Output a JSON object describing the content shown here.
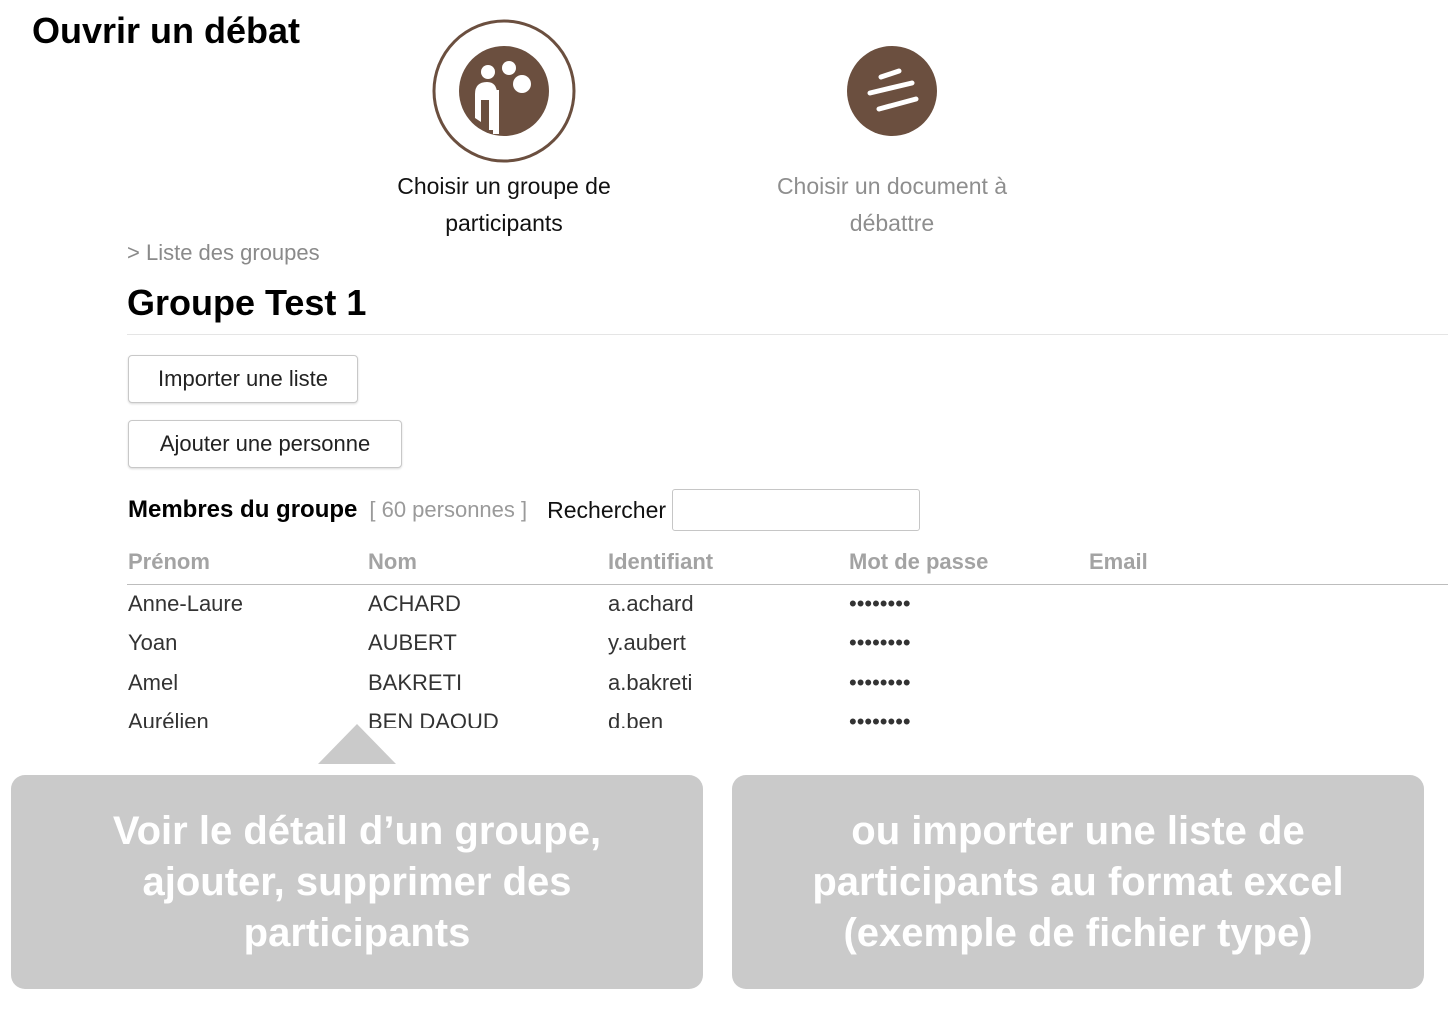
{
  "page": {
    "title": "Ouvrir un débat"
  },
  "steps": [
    {
      "label_line1": "Choisir un groupe de",
      "label_line2": "participants",
      "icon": "participants-group-icon",
      "state": "active"
    },
    {
      "label_line1": "Choisir un document à",
      "label_line2": "débattre",
      "icon": "document-icon",
      "state": "inactive"
    }
  ],
  "breadcrumb": "> Liste des groupes",
  "group": {
    "title": "Groupe Test 1"
  },
  "actions": {
    "import_label": "Importer une liste",
    "add_label": "Ajouter une personne"
  },
  "members": {
    "label": "Membres du groupe",
    "count": "[ 60 personnes ]",
    "search_label": "Rechercher",
    "search_value": ""
  },
  "table": {
    "headers": [
      "Prénom",
      "Nom",
      "Identifiant",
      "Mot de passe",
      "Email"
    ],
    "rows": [
      [
        "Anne-Laure",
        "ACHARD",
        "a.achard",
        "••••••••",
        ""
      ],
      [
        "Yoan",
        "AUBERT",
        "y.aubert",
        "••••••••",
        ""
      ],
      [
        "Amel",
        "BAKRETI",
        "a.bakreti",
        "••••••••",
        ""
      ],
      [
        "Aurélien",
        "BEN DAOUD",
        "d.ben",
        "••••••••",
        ""
      ]
    ]
  },
  "callouts": {
    "left": "Voir le détail d’un groupe, ajouter, supprimer des participants",
    "right": "ou importer une liste de participants au format excel (exemple de fichier type)"
  },
  "colors": {
    "brand_brown": "#6b4f3f",
    "callout_gray": "#cacaca"
  }
}
